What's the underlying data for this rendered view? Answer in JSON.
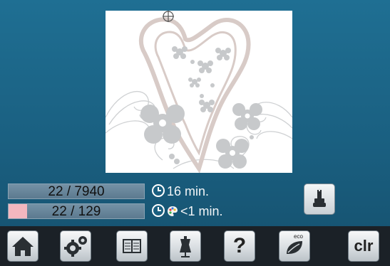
{
  "status": {
    "stitch_counter": "22 / 7940",
    "color_counter": "22 / 129",
    "time_total": "16 min.",
    "time_color": "<1 min."
  },
  "colors": {
    "background": "#1a5f80",
    "current_thread": "#f3b7bf",
    "design_outline": "#d8cbc7",
    "design_flowers": "#c7c9cb"
  },
  "icons": [
    "clock-icon",
    "palette-icon",
    "presser-foot-icon",
    "home-icon",
    "settings-icon",
    "book-icon",
    "mannequin-icon",
    "help-icon",
    "eco-icon"
  ],
  "toolbar": {
    "help_label": "?",
    "eco_label": "eco",
    "clr_label": "clr"
  }
}
